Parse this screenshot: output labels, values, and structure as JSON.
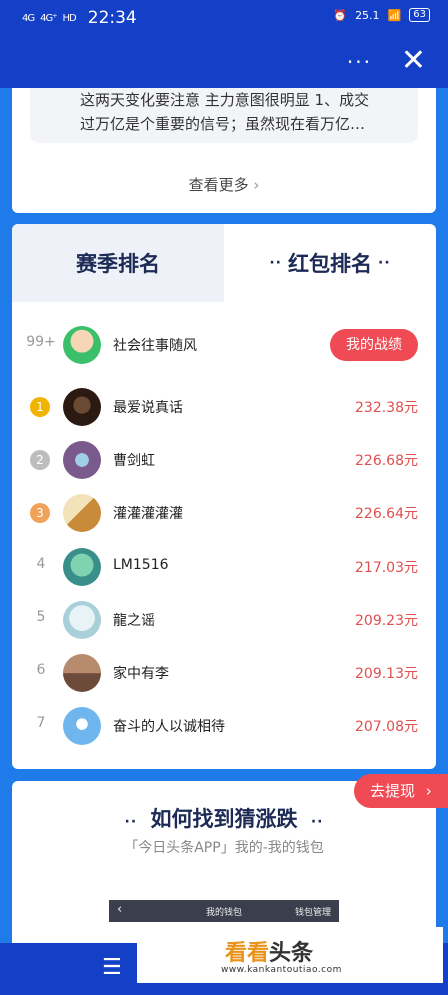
{
  "status_bar": {
    "signal1": "4G",
    "signal2": "4G⁺",
    "hd": "HD",
    "time": "22:34",
    "speed": "25.1",
    "battery": "63"
  },
  "top_card": {
    "excerpt_line1": "这两天变化要注意 主力意图很明显 1、成交",
    "excerpt_line2": "过万亿是个重要的信号；虽然现在看万亿…",
    "view_more": "查看更多"
  },
  "tabs": {
    "season": "赛季排名",
    "redpacket": "红包排名",
    "dots": "··"
  },
  "my_row": {
    "rank": "99+",
    "name": "社会往事随风",
    "button": "我的战绩"
  },
  "currency": "元",
  "rankings": [
    {
      "rank": "1",
      "name": "最爱说真话",
      "amount": "232.38元"
    },
    {
      "rank": "2",
      "name": "曹剑虹",
      "amount": "226.68元"
    },
    {
      "rank": "3",
      "name": "灌灌灌灌灌",
      "amount": "226.64元"
    },
    {
      "rank": "4",
      "name": "LM1516",
      "amount": "217.03元"
    },
    {
      "rank": "5",
      "name": "龍之谣",
      "amount": "209.23元"
    },
    {
      "rank": "6",
      "name": "家中有李",
      "amount": "209.13元"
    },
    {
      "rank": "7",
      "name": "奋斗的人以诚相待",
      "amount": "207.08元"
    }
  ],
  "how_card": {
    "title": "如何找到猜涨跌",
    "subtitle": "「今日头条APP」我的-我的钱包",
    "wallet_title": "我的钱包",
    "wallet_manage": "钱包管理"
  },
  "withdraw": {
    "label": "去提现"
  },
  "watermark": {
    "logo_part1": "看看",
    "logo_part2": "头条",
    "url": "www.kankantoutiao.com"
  },
  "colors": {
    "header": "#1440c8",
    "page_bg": "#1f7bea",
    "accent_red": "#f04a54",
    "amount_red": "#e0504f",
    "gold": "#f0b400",
    "silver": "#bdbdbd",
    "bronze": "#f0a25a"
  }
}
